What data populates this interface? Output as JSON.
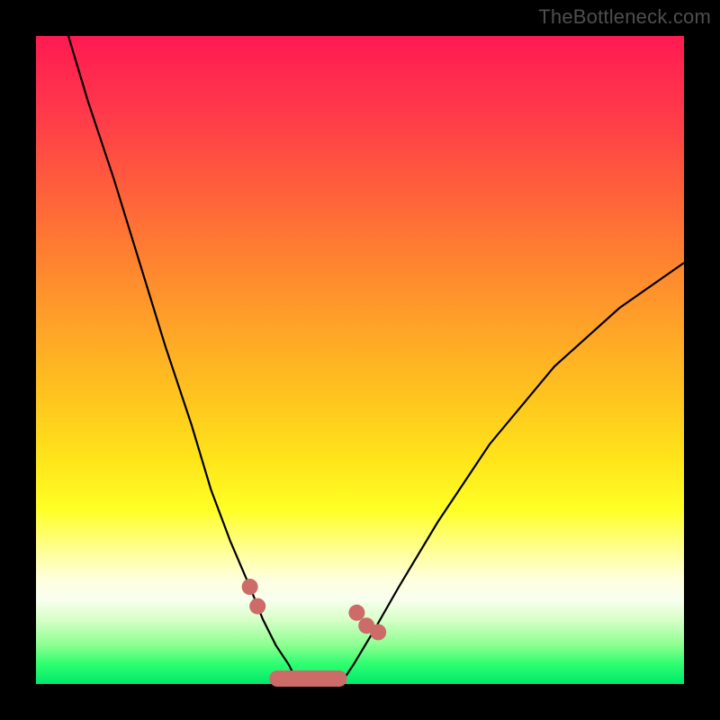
{
  "watermark": "TheBottleneck.com",
  "chart_data": {
    "type": "line",
    "title": "",
    "xlabel": "",
    "ylabel": "",
    "xlim": [
      0,
      100
    ],
    "ylim": [
      0,
      100
    ],
    "background_gradient": {
      "top_color": "#ff1a52",
      "mid_color": "#ffe31a",
      "bottom_color": "#00e86a",
      "meaning": "top = severe bottleneck (red), bottom = optimal (green)"
    },
    "series": [
      {
        "name": "left-curve",
        "x": [
          5,
          8,
          12,
          16,
          20,
          24,
          27,
          30,
          33,
          35,
          37,
          39,
          40.5
        ],
        "values": [
          100,
          90,
          78,
          65,
          52,
          40,
          30,
          22,
          15,
          10,
          6,
          3,
          0
        ]
      },
      {
        "name": "right-curve",
        "x": [
          47,
          49,
          52,
          56,
          62,
          70,
          80,
          90,
          100
        ],
        "values": [
          0,
          3,
          8,
          15,
          25,
          37,
          49,
          58,
          65
        ]
      }
    ],
    "markers": [
      {
        "x": 33.0,
        "y": 15,
        "label": "left-upper"
      },
      {
        "x": 34.2,
        "y": 12,
        "label": "left-upper-2"
      },
      {
        "x": 49.5,
        "y": 11,
        "label": "right-upper"
      },
      {
        "x": 51.0,
        "y": 9,
        "label": "right-upper-2"
      },
      {
        "x": 52.8,
        "y": 8,
        "label": "right-upper-3"
      }
    ],
    "bottom_pill": {
      "x_start": 36,
      "x_end": 48,
      "y": 0,
      "label": "optimal-zone-marker"
    }
  }
}
